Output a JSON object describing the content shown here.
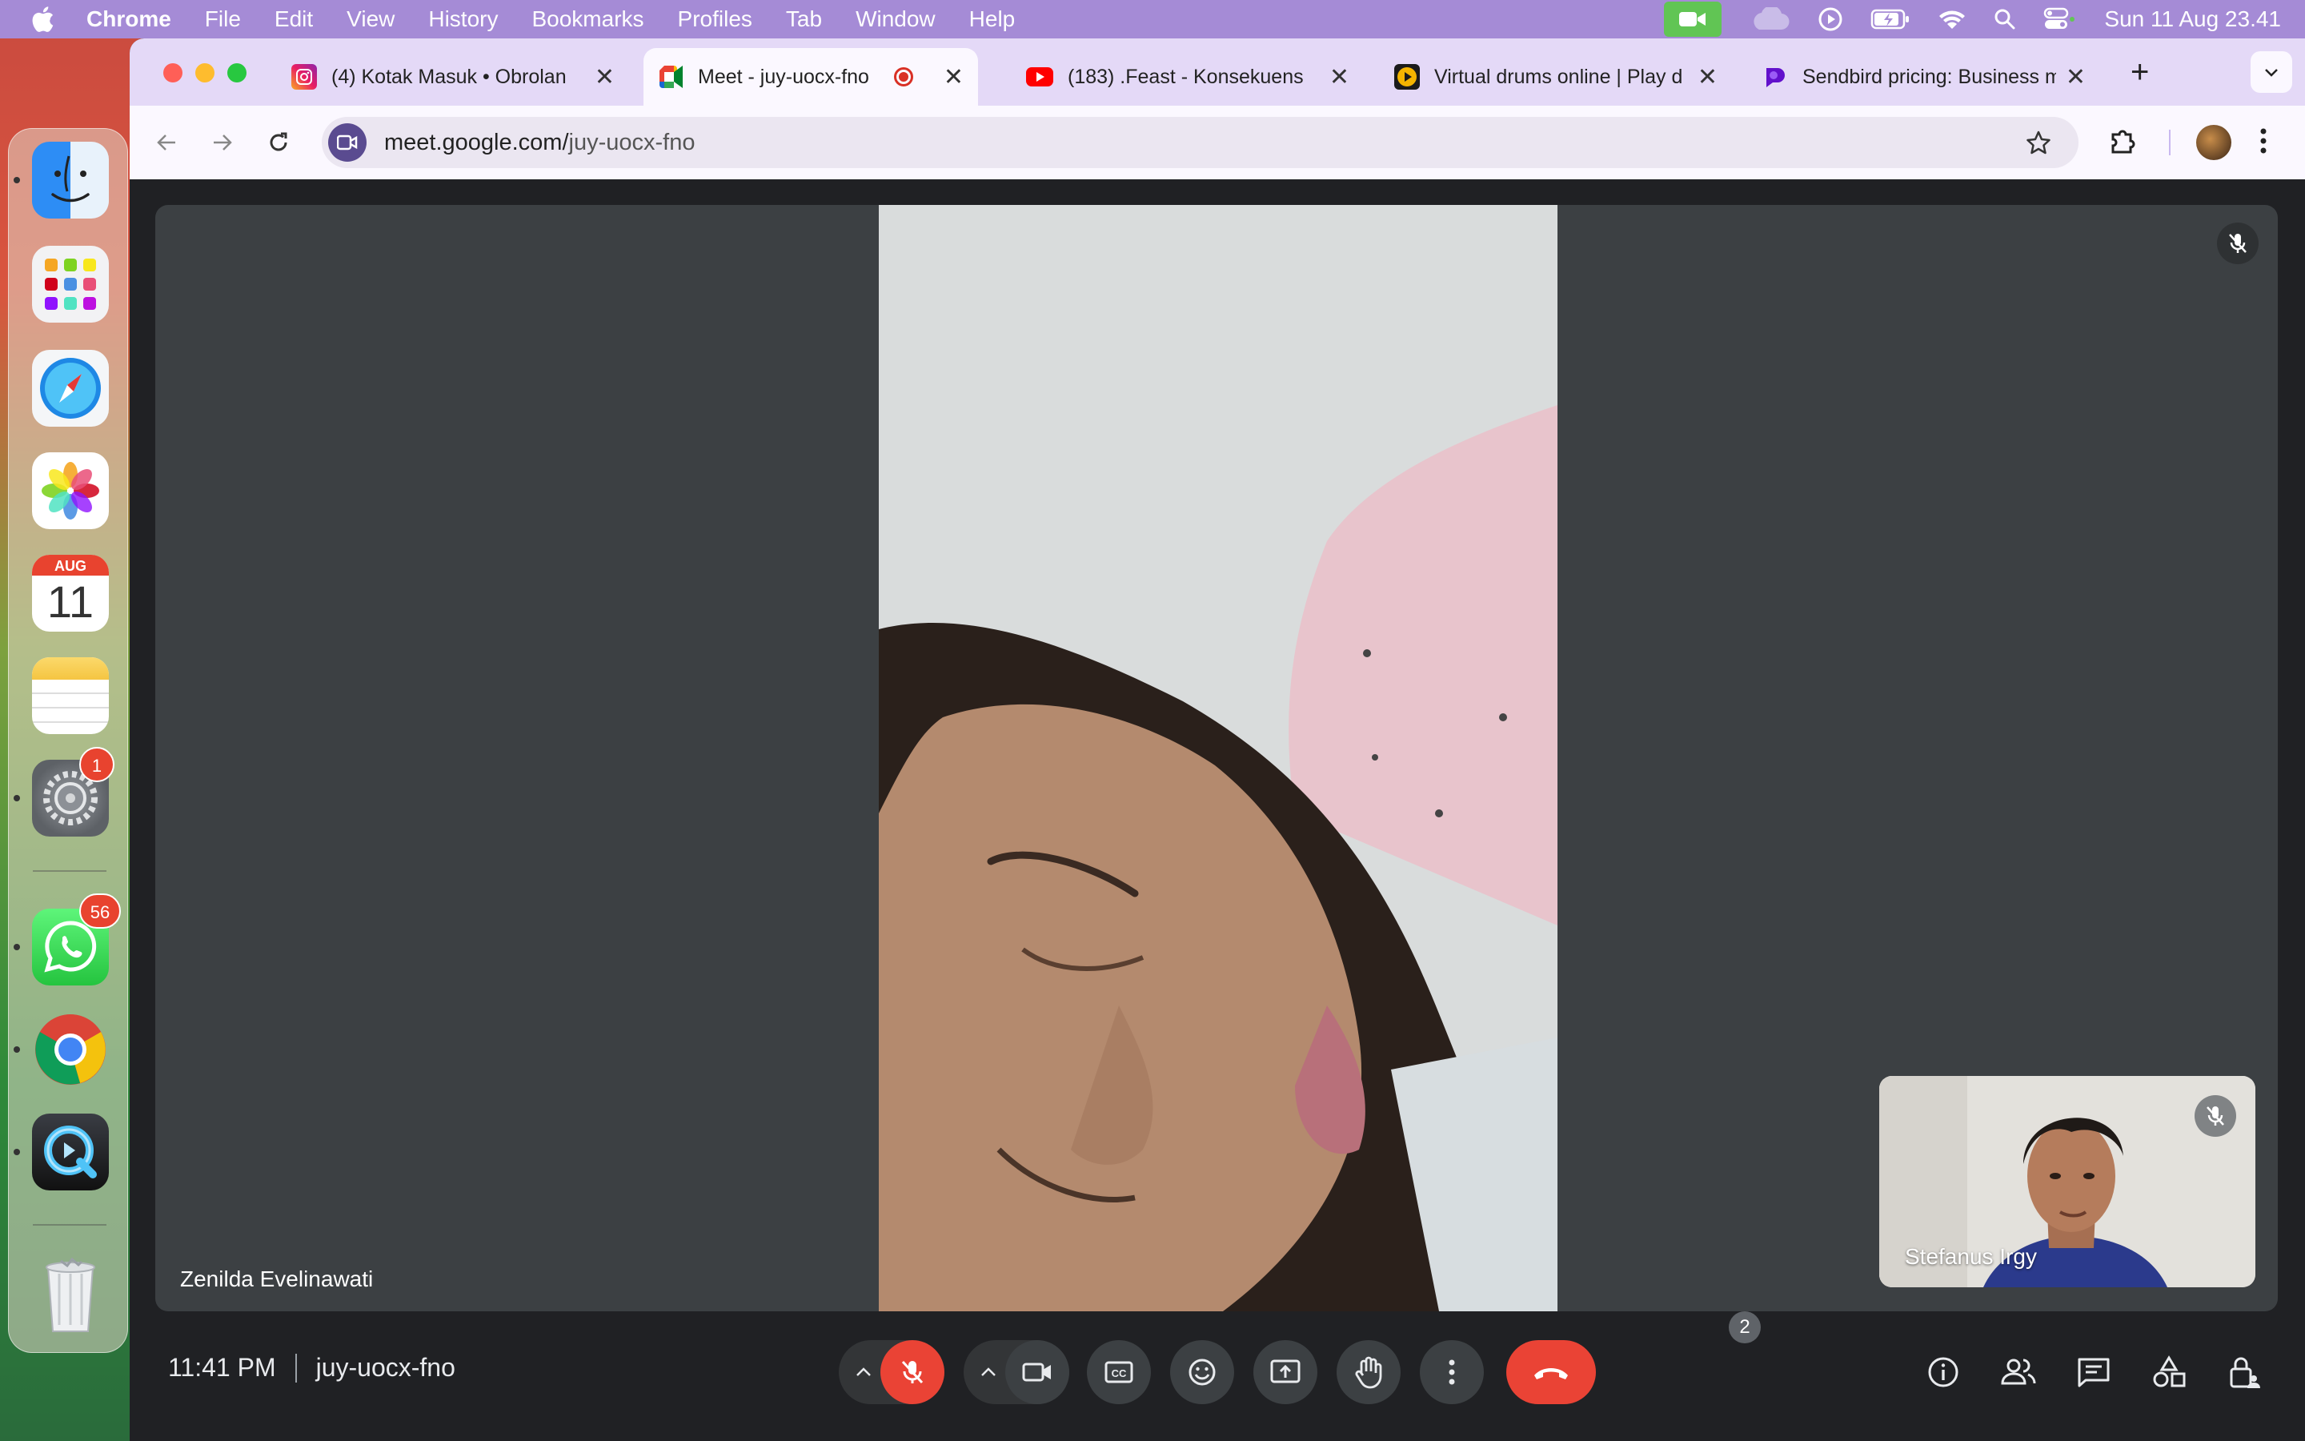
{
  "menubar": {
    "app_name": "Chrome",
    "menus": [
      "File",
      "Edit",
      "View",
      "History",
      "Bookmarks",
      "Profiles",
      "Tab",
      "Window",
      "Help"
    ],
    "clock": "Sun 11 Aug  23.41",
    "status_icons": [
      "facetime-icon",
      "icloud-icon",
      "play-icon",
      "battery-icon",
      "wifi-icon",
      "spotlight-icon",
      "control-center-icon"
    ]
  },
  "dock": {
    "apps": [
      {
        "name": "Finder",
        "icon": "finder-icon"
      },
      {
        "name": "Launchpad",
        "icon": "launchpad-icon"
      },
      {
        "name": "Safari",
        "icon": "safari-icon"
      },
      {
        "name": "Photos",
        "icon": "photos-icon"
      },
      {
        "name": "Calendar",
        "icon": "calendar-icon",
        "month": "AUG",
        "day": "11"
      },
      {
        "name": "Notes",
        "icon": "notes-icon"
      },
      {
        "name": "System Settings",
        "icon": "settings-icon",
        "badge": "1"
      },
      {
        "name": "WhatsApp",
        "icon": "whatsapp-icon",
        "badge": "56"
      },
      {
        "name": "Chrome",
        "icon": "chrome-icon"
      },
      {
        "name": "QuickTime Player",
        "icon": "quicktime-icon"
      },
      {
        "name": "Trash",
        "icon": "trash-icon"
      }
    ]
  },
  "browser": {
    "tabs": [
      {
        "title": "(4) Kotak Masuk • Obrolan",
        "icon": "instagram-icon"
      },
      {
        "title": "Meet - juy-uocx-fno",
        "icon": "google-meet-icon",
        "active": true
      },
      {
        "title": "(183) .Feast - Konsekuens",
        "icon": "youtube-icon"
      },
      {
        "title": "Virtual drums online | Play d",
        "icon": "drums-icon"
      },
      {
        "title": "Sendbird pricing: Business m",
        "icon": "sendbird-icon"
      }
    ],
    "url_host": "meet.google.com/",
    "url_path": "juy-uocx-fno"
  },
  "meet": {
    "main_participant": "Zenilda Evelinawati",
    "self_participant": "Stefanus Irgy",
    "time": "11:41 PM",
    "meeting_code": "juy-uocx-fno",
    "participant_count": "2",
    "colors": {
      "end_call": "#ea4335",
      "stage": "#3c4043",
      "bar": "#202124"
    }
  }
}
